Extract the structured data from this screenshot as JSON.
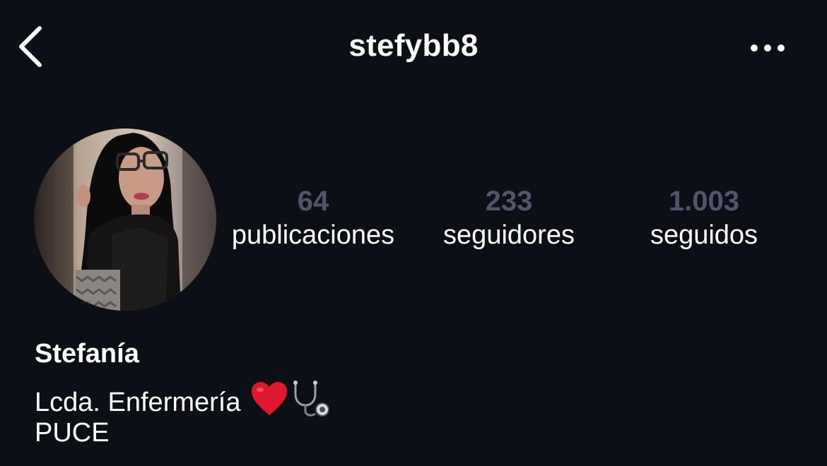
{
  "header": {
    "username": "stefybb8",
    "back_icon": "chevron-left-icon",
    "more_icon": "more-horizontal-icon"
  },
  "profile": {
    "stats": {
      "posts": {
        "value": "64",
        "label": "publicaciones"
      },
      "followers": {
        "value": "233",
        "label": "seguidores"
      },
      "following": {
        "value": "1.003",
        "label": "seguidos"
      }
    },
    "name": "Stefanía",
    "bio_line1": "Lcda. Enfermería",
    "bio_emojis": [
      "red-heart-icon",
      "stethoscope-icon"
    ],
    "bio_line2": "PUCE"
  },
  "colors": {
    "background": "#0d0f16",
    "stat_number": "#50566a",
    "text": "#ffffff",
    "heart": "#e0182d"
  }
}
